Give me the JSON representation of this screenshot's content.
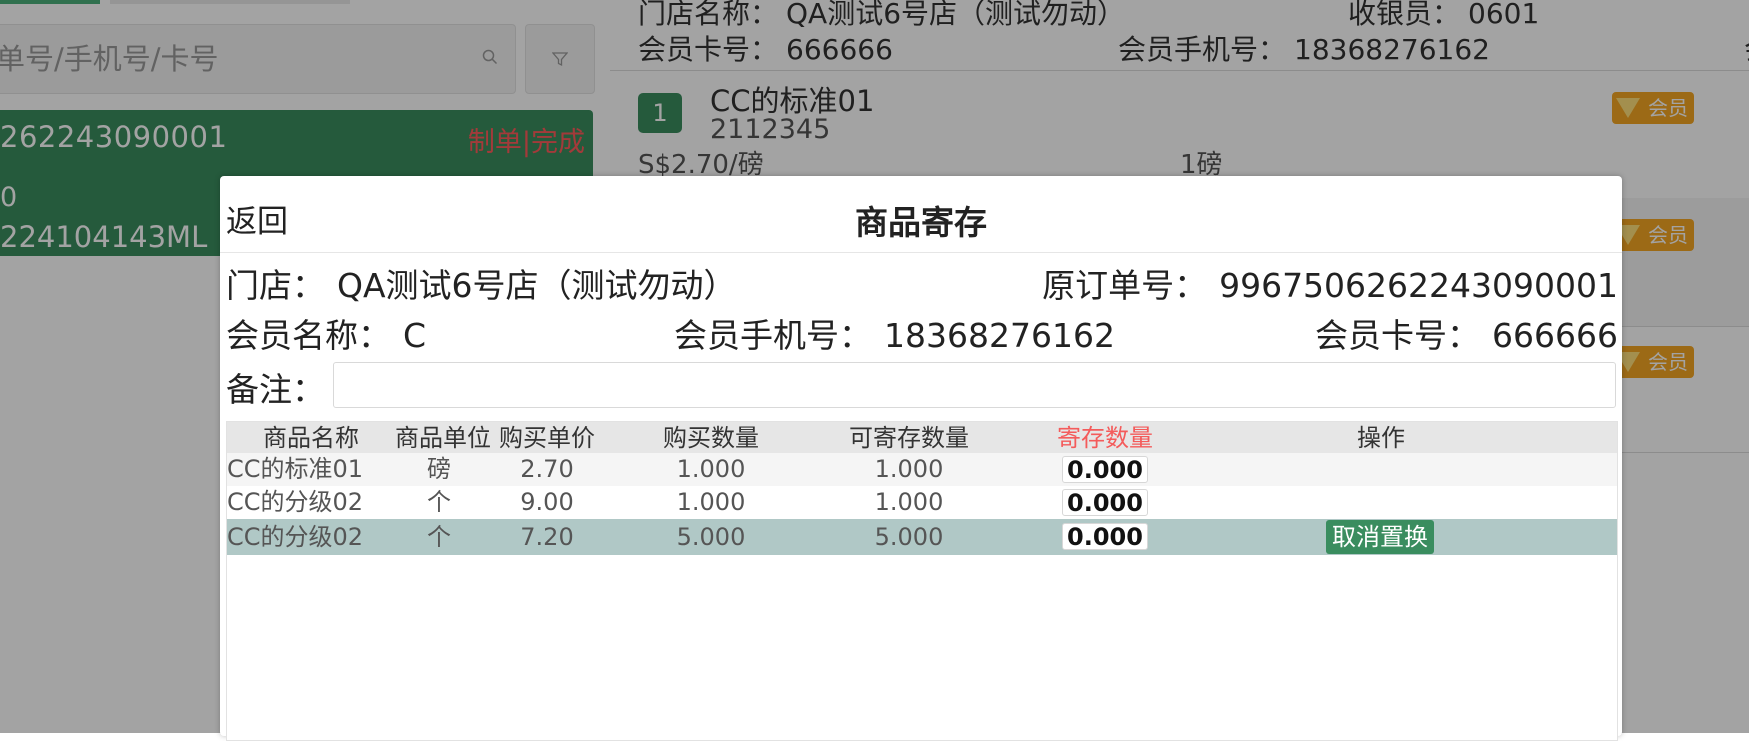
{
  "background": {
    "left": {
      "search": {
        "placeholder": "单号/手机号/卡号"
      },
      "order": {
        "number": "262243090001",
        "status": "制单|完成",
        "dot": "0",
        "code": "224104143ML"
      }
    },
    "right": {
      "store_label": "门店名称：",
      "store_value": "QA测试6号店（测试勿动）",
      "cashier_label": "收银员：",
      "cashier_value": "0601",
      "card_label": "会员卡号：",
      "card_value": "666666",
      "phone_label": "会员手机号：",
      "phone_value": "18368276162",
      "extra_label": "会员",
      "item": {
        "index": "1",
        "name": "CC的标准01",
        "code": "2112345",
        "price": "S$2.70/磅",
        "qty": "1磅"
      },
      "member_tag": "会员"
    }
  },
  "modal": {
    "back": "返回",
    "title": "商品寄存",
    "store_label": "门店：",
    "store_value": "QA测试6号店（测试勿动）",
    "orig_order_label": "原订单号：",
    "orig_order_value": "9967506262243090001",
    "member_name_label": "会员名称：",
    "member_name_value": "C",
    "member_phone_label": "会员手机号：",
    "member_phone_value": "18368276162",
    "member_card_label": "会员卡号：",
    "member_card_value": "666666",
    "remark_label": "备注：",
    "remark_value": "",
    "table": {
      "headers": [
        "商品名称",
        "商品单位",
        "购买单价",
        "购买数量",
        "可寄存数量",
        "寄存数量",
        "操作"
      ],
      "rows": [
        {
          "name": "CC的标准01",
          "unit": "磅",
          "price": "2.70",
          "qty": "1.000",
          "storable": "1.000",
          "store_qty": "0.000",
          "action": ""
        },
        {
          "name": "CC的分级02",
          "unit": "个",
          "price": "9.00",
          "qty": "1.000",
          "storable": "1.000",
          "store_qty": "0.000",
          "action": ""
        },
        {
          "name": "CC的分级02",
          "unit": "个",
          "price": "7.20",
          "qty": "5.000",
          "storable": "5.000",
          "store_qty": "0.000",
          "action": "取消置换"
        }
      ]
    }
  },
  "colors": {
    "brand_green": "#3a8d5f",
    "highlight_row": "#b0c8c6",
    "alert_red": "#f45b5b",
    "member_orange": "#f5a623"
  }
}
